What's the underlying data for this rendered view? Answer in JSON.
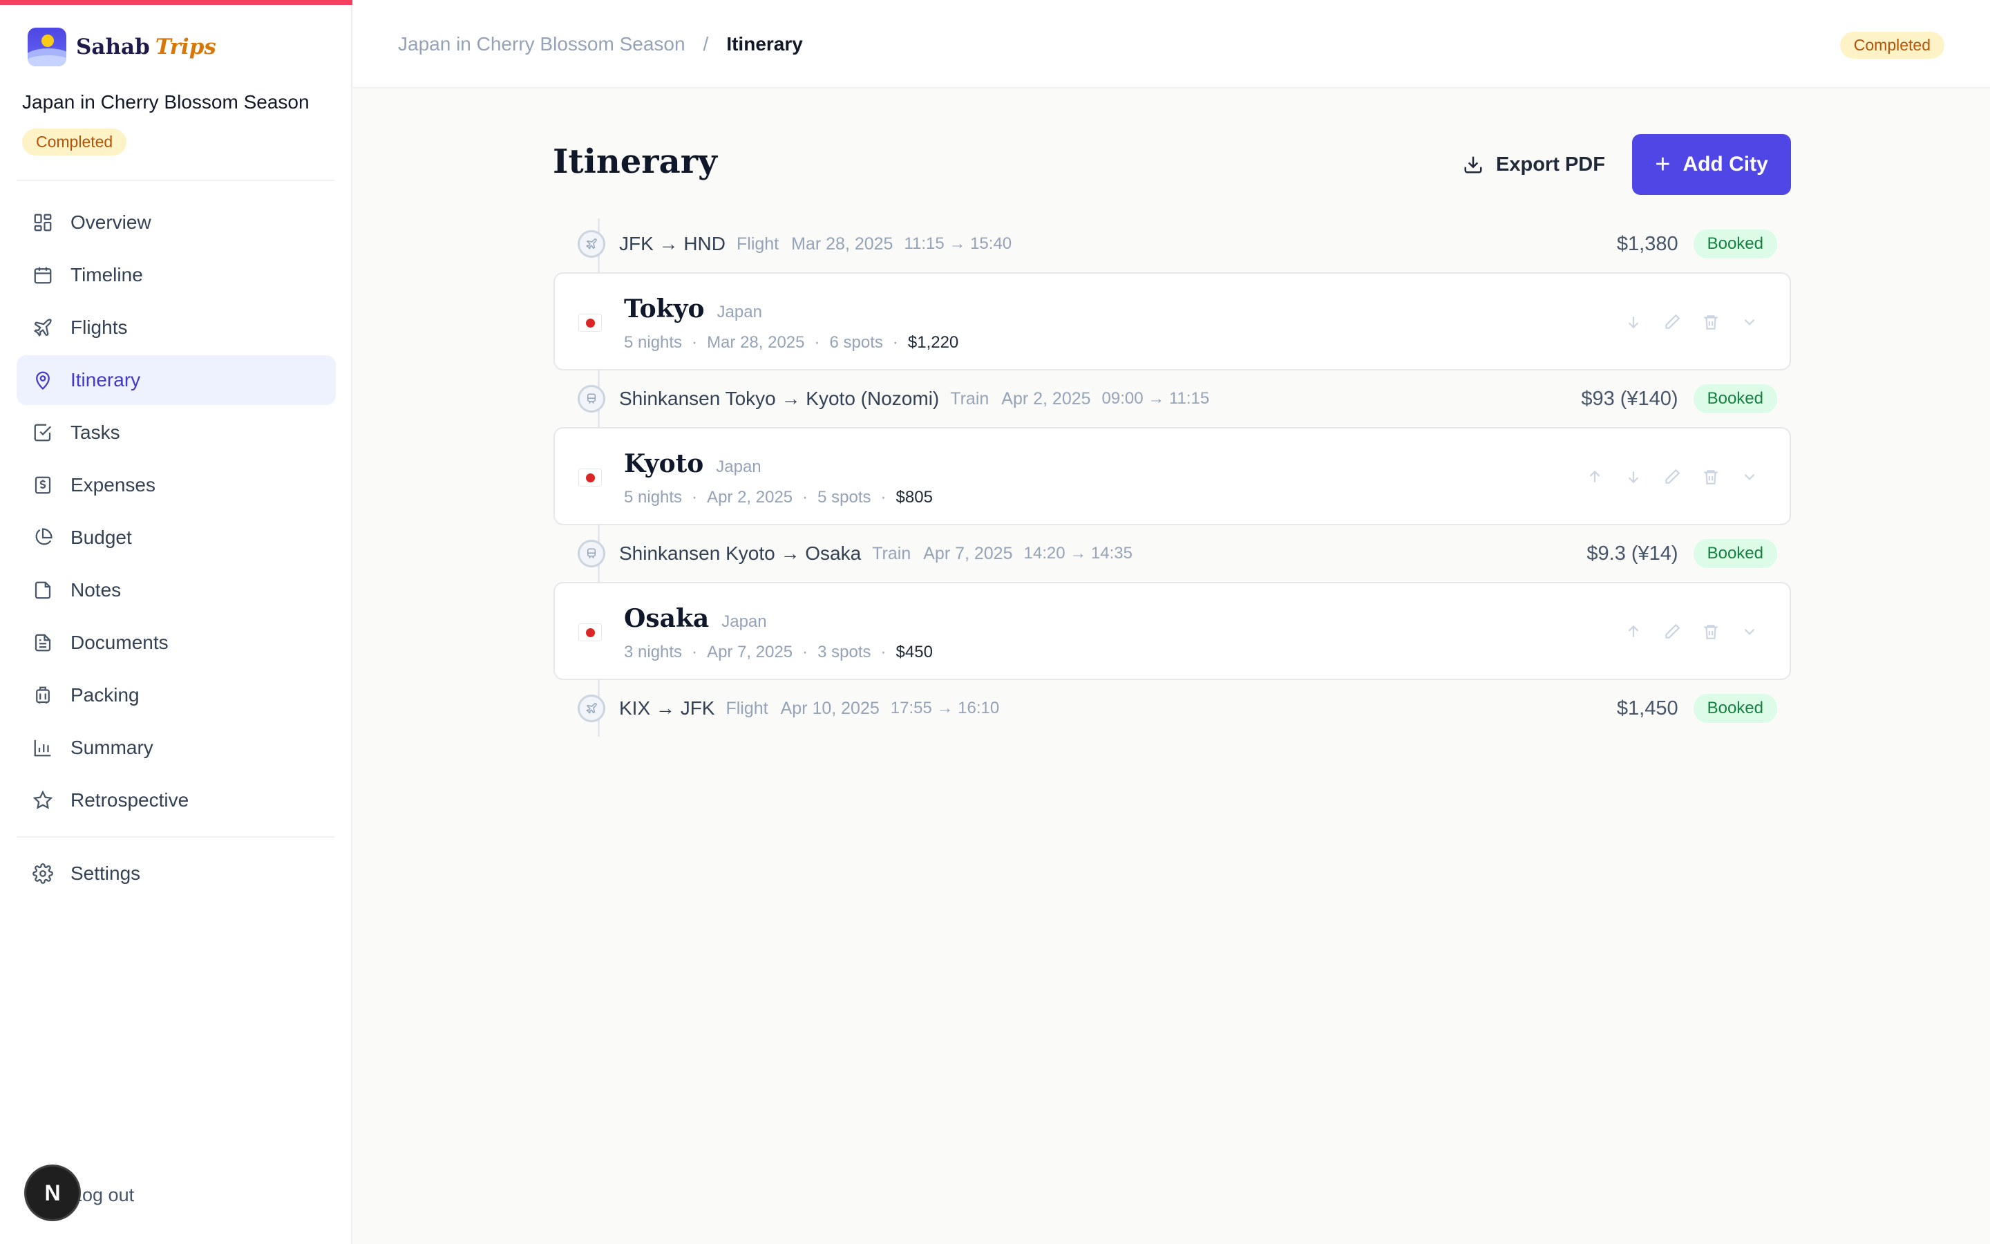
{
  "brand": {
    "name": "Sahab",
    "accent": "Trips"
  },
  "trip": {
    "title": "Japan in Cherry Blossom Season",
    "status": "Completed"
  },
  "nav": [
    {
      "label": "Overview",
      "icon": "grid-icon"
    },
    {
      "label": "Timeline",
      "icon": "calendar-icon"
    },
    {
      "label": "Flights",
      "icon": "plane-icon"
    },
    {
      "label": "Itinerary",
      "icon": "map-pin-icon",
      "active": true
    },
    {
      "label": "Tasks",
      "icon": "check-square-icon"
    },
    {
      "label": "Expenses",
      "icon": "dollar-receipt-icon"
    },
    {
      "label": "Budget",
      "icon": "pie-chart-icon"
    },
    {
      "label": "Notes",
      "icon": "note-icon"
    },
    {
      "label": "Documents",
      "icon": "document-icon"
    },
    {
      "label": "Packing",
      "icon": "luggage-icon"
    },
    {
      "label": "Summary",
      "icon": "bar-chart-icon"
    },
    {
      "label": "Retrospective",
      "icon": "star-icon"
    }
  ],
  "settings": {
    "label": "Settings",
    "icon": "gear-icon"
  },
  "logout": {
    "label": "Log out",
    "avatar": "N"
  },
  "breadcrumb": {
    "parent": "Japan in Cherry Blossom Season",
    "separator": "/",
    "current": "Itinerary"
  },
  "header": {
    "status": "Completed"
  },
  "page": {
    "title": "Itinerary",
    "export_label": "Export PDF",
    "add_label": "Add City"
  },
  "segments": [
    {
      "route": "JFK → HND",
      "mode": "Flight",
      "date": "Mar 28, 2025",
      "time": "11:15 → 15:40",
      "price": "$1,380",
      "status": "Booked",
      "icon": "plane-icon"
    },
    {
      "route": "Shinkansen Tokyo → Kyoto (Nozomi)",
      "mode": "Train",
      "date": "Apr 2, 2025",
      "time": "09:00 → 11:15",
      "price": "$93 (¥140)",
      "status": "Booked",
      "icon": "train-icon"
    },
    {
      "route": "Shinkansen Kyoto → Osaka",
      "mode": "Train",
      "date": "Apr 7, 2025",
      "time": "14:20 → 14:35",
      "price": "$9.3 (¥14)",
      "status": "Booked",
      "icon": "train-icon"
    },
    {
      "route": "KIX → JFK",
      "mode": "Flight",
      "date": "Apr 10, 2025",
      "time": "17:55 → 16:10",
      "price": "$1,450",
      "status": "Booked",
      "icon": "plane-icon"
    }
  ],
  "cities": [
    {
      "name": "Tokyo",
      "country": "Japan",
      "nights": "5 nights",
      "date": "Mar 28, 2025",
      "spots": "6 spots",
      "cost": "$1,220",
      "flag": "japan-flag-icon"
    },
    {
      "name": "Kyoto",
      "country": "Japan",
      "nights": "5 nights",
      "date": "Apr 2, 2025",
      "spots": "5 spots",
      "cost": "$805",
      "flag": "japan-flag-icon"
    },
    {
      "name": "Osaka",
      "country": "Japan",
      "nights": "3 nights",
      "date": "Apr 7, 2025",
      "spots": "3 spots",
      "cost": "$450",
      "flag": "japan-flag-icon"
    }
  ],
  "colors": {
    "accent": "#4f46e5",
    "top_bar": "#f43f5e",
    "badge_completed_bg": "#fef3c7",
    "badge_booked_bg": "#dcfce7"
  }
}
